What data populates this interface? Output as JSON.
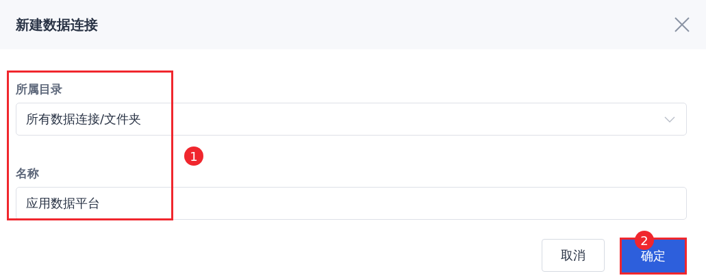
{
  "dialog": {
    "title": "新建数据连接"
  },
  "fields": [
    {
      "label": "所属目录",
      "kind": "select",
      "value": "所有数据连接/文件夹"
    },
    {
      "label": "名称",
      "kind": "text",
      "value": "应用数据平台"
    }
  ],
  "buttons": [
    {
      "label": "取消",
      "kind": "secondary"
    },
    {
      "label": "确定",
      "kind": "primary"
    }
  ],
  "annotations": [
    {
      "number": "1"
    },
    {
      "number": "2"
    }
  ]
}
